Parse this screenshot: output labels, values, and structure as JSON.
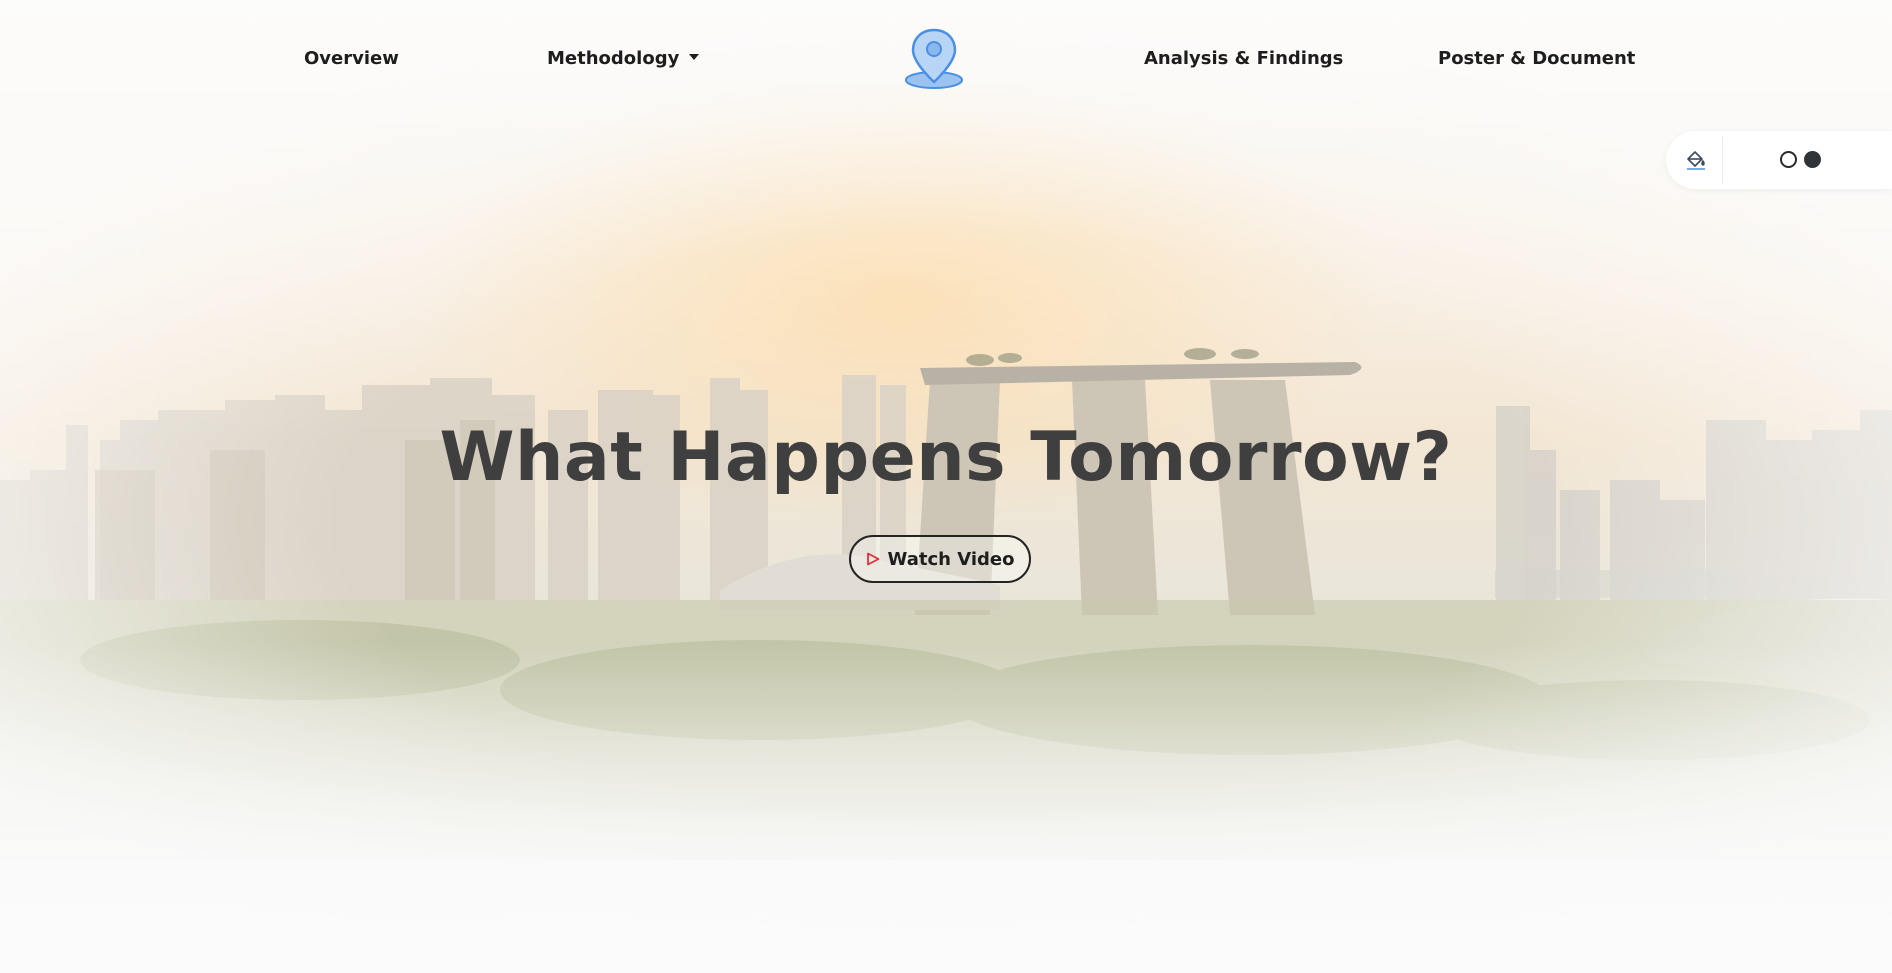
{
  "nav": {
    "items": [
      {
        "label": "Overview"
      },
      {
        "label": "Methodology",
        "has_dropdown": true
      },
      {
        "label": "Analysis & Findings"
      },
      {
        "label": "Poster & Document"
      }
    ],
    "logo_icon": "map-pin-icon"
  },
  "theme_switcher": {
    "paint_icon": "paint-bucket-icon",
    "options": [
      "light",
      "dark"
    ]
  },
  "hero": {
    "title": "What Happens Tomorrow?",
    "cta_label": "Watch Video",
    "cta_icon": "play-icon"
  },
  "colors": {
    "accent_blue": "#4a90e2",
    "play_red": "#e0333a",
    "title_text": "#3f3f3f"
  }
}
